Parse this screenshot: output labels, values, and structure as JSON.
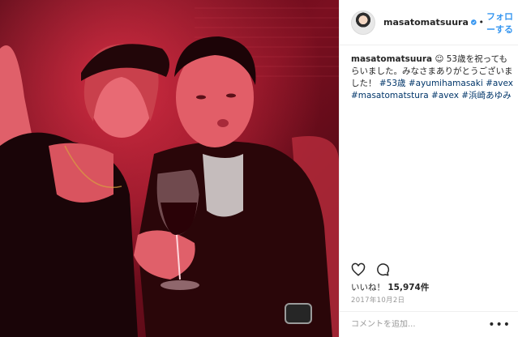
{
  "post": {
    "photo_icon": "photo-image",
    "header": {
      "username": "masatomatsuura",
      "verified_icon": "verified-badge-icon",
      "separator": "•",
      "follow_label": "フォローする"
    },
    "caption": {
      "username": "masatomatsuura",
      "emoji": "☺",
      "text": "53歳を祝ってもらいました。みなさまありがとうございました！",
      "hashtags": "#53歳 #ayumihamasaki #avex #masatomatstura #avex #浜崎あゆみ"
    },
    "actions": {
      "like_icon": "heart-icon",
      "comment_icon": "comment-icon"
    },
    "likes_label": "いいね！",
    "likes_count": "15,974件",
    "date": "2017年10月2日",
    "comment_placeholder": "コメントを追加...",
    "more_label": "•••"
  },
  "colors": {
    "accent": "#3897f0",
    "hashtag": "#003569"
  }
}
